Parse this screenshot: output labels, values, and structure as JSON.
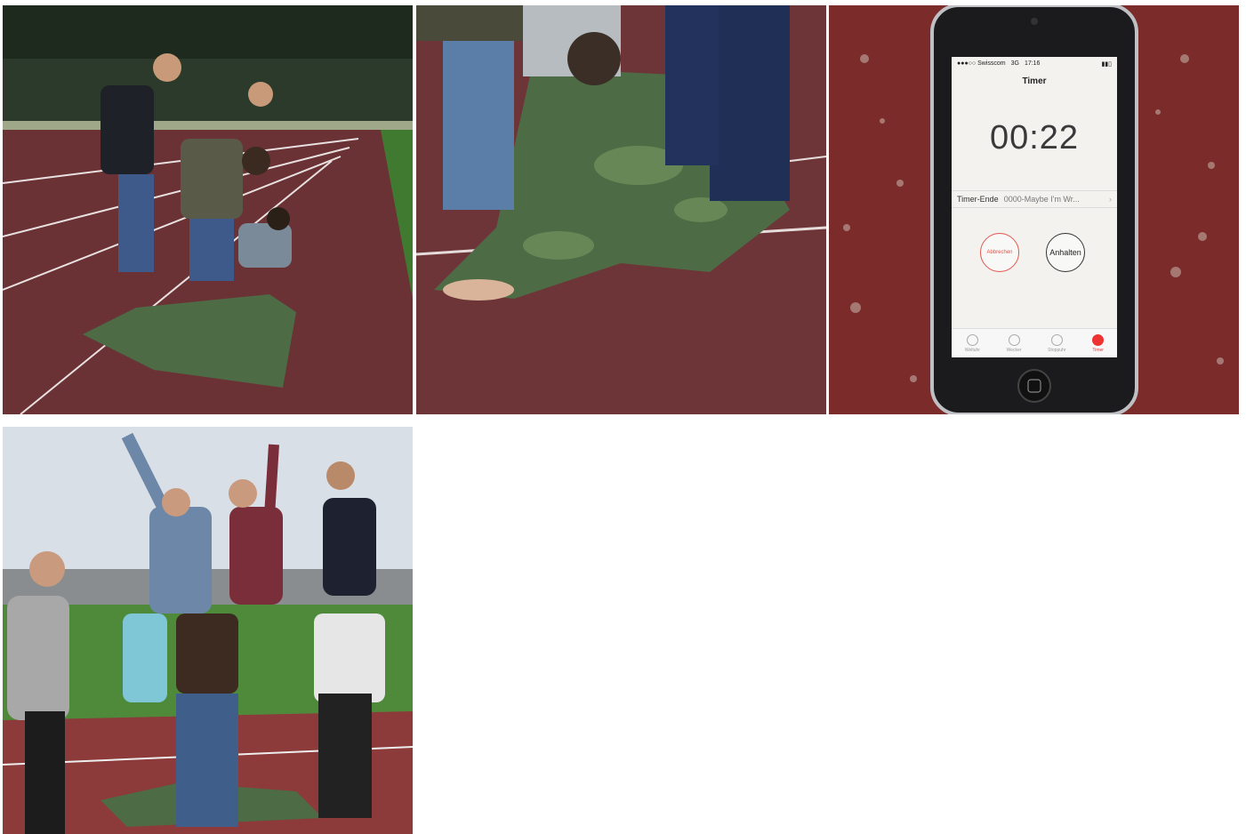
{
  "gallery": {
    "tiles": [
      {
        "id": "t1",
        "scene": "human-pyramid-on-tarp-running-track"
      },
      {
        "id": "t2",
        "scene": "folding-camouflage-tarp-barefoot"
      },
      {
        "id": "t3",
        "scene": "phone-timer-on-track-surface"
      },
      {
        "id": "t4",
        "scene": "celebrating-shoulder-riders-on-tarp"
      }
    ]
  },
  "phone": {
    "status": {
      "carrier": "●●●○○ Swisscom",
      "network": "3G",
      "time": "17:16",
      "battery": "▮▮▯"
    },
    "title": "Timer",
    "countdown": "00:22",
    "timer_end_label": "Timer-Ende",
    "timer_end_value": "0000-Maybe I'm Wr...",
    "chevron": "›",
    "cancel_label": "Abbrechen",
    "pause_label": "Anhalten",
    "tabs": [
      {
        "label": "Weltuhr",
        "icon": "globe-icon"
      },
      {
        "label": "Wecker",
        "icon": "alarm-clock-icon"
      },
      {
        "label": "Stoppuhr",
        "icon": "stopwatch-icon"
      },
      {
        "label": "Timer",
        "icon": "timer-icon",
        "active": true
      }
    ]
  },
  "colors": {
    "track": "#6b3236",
    "tarp": "#4d6b44",
    "grass": "#4f8a3a",
    "accent_red": "#e33333"
  }
}
